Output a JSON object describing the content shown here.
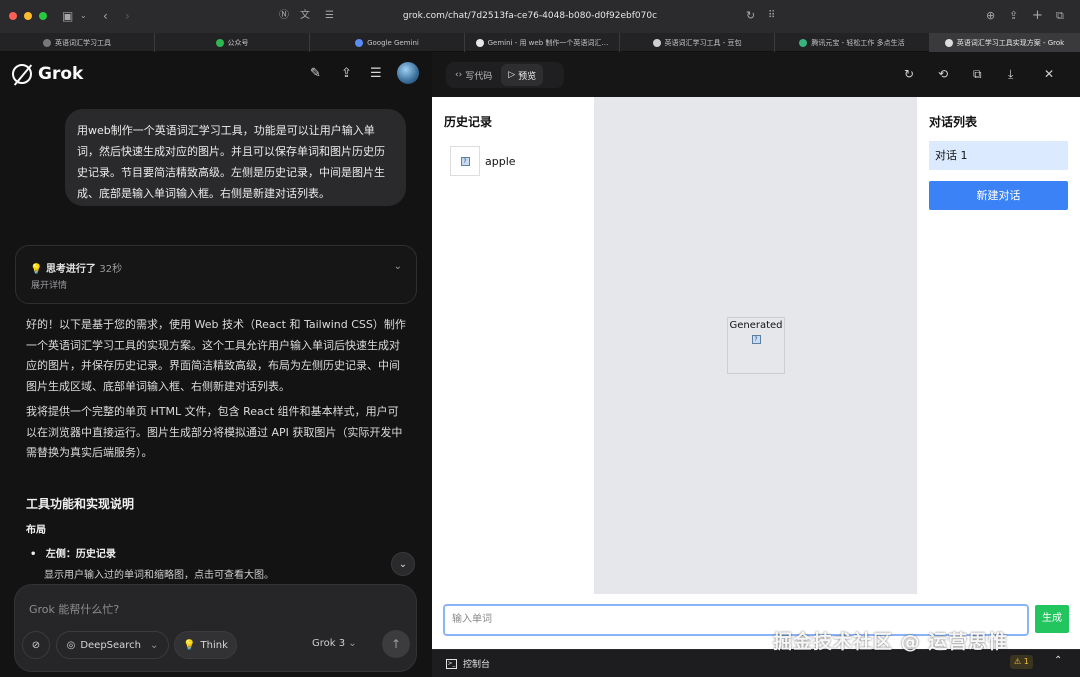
{
  "browser": {
    "url": "grok.com/chat/7d2513fa-ce76-4048-b080-d0f92ebf070c",
    "tabs": [
      {
        "label": "英语词汇学习工具",
        "active": false
      },
      {
        "label": "公众号",
        "active": false
      },
      {
        "label": "Google Gemini",
        "active": false
      },
      {
        "label": "Gemini - 用 web 制作一个英语词汇…",
        "active": false
      },
      {
        "label": "英语词汇学习工具 - 豆包",
        "active": false
      },
      {
        "label": "腾讯元宝 - 轻松工作 多点生活",
        "active": false
      },
      {
        "label": "英语词汇学习工具实现方案 - Grok",
        "active": true
      }
    ]
  },
  "chat": {
    "brand": "Grok",
    "user_message": "用web制作一个英语词汇学习工具，功能是可以让用户输入单词，然后快速生成对应的图片。并且可以保存单词和图片历史历史记录。节目要简洁精致高级。左侧是历史记录，中间是图片生成、底部是输入单词输入框。右侧是新建对话列表。",
    "thinking": {
      "title": "思考进行了",
      "seconds": "32秒",
      "expand": "展开详情"
    },
    "paragraph1": "好的！以下是基于您的需求，使用 Web 技术（React 和 Tailwind CSS）制作一个英语词汇学习工具的实现方案。这个工具允许用户输入单词后快速生成对应的图片，并保存历史记录。界面简洁精致高级，布局为左侧历史记录、中间图片生成区域、底部单词输入框、右侧新建对话列表。",
    "paragraph2": "我将提供一个完整的单页 HTML 文件，包含 React 组件和基本样式，用户可以在浏览器中直接运行。图片生成部分将模拟通过 API 获取图片（实际开发中需替换为真实后端服务）。",
    "section_title": "工具功能和实现说明",
    "subsection_title": "布局",
    "bullet_title": "左侧：历史记录",
    "bullet_text": "显示用户输入过的单词和缩略图，点击可查看大图。",
    "composer_placeholder": "Grok 能帮什么忙?",
    "deepsearch_label": "DeepSearch",
    "think_label": "Think",
    "model_label": "Grok 3"
  },
  "preview": {
    "code_tab": "写代码",
    "preview_tab": "预览",
    "history_title": "历史记录",
    "history_items": [
      {
        "word": "apple"
      }
    ],
    "generated_label": "Generated",
    "conversations_title": "对话列表",
    "conversations": [
      {
        "label": "对话 1"
      }
    ],
    "new_conversation": "新建对话",
    "input_placeholder": "输入单词",
    "generate_button": "生成",
    "console_label": "控制台",
    "warning_count": "1"
  },
  "watermark": "掘金技术社区 @ 运营思惟",
  "colors": {
    "accent_blue": "#3b82f6",
    "generate_green": "#22c55e",
    "active_conversation": "#dbeafe",
    "center_panel": "#e5e7eb"
  }
}
